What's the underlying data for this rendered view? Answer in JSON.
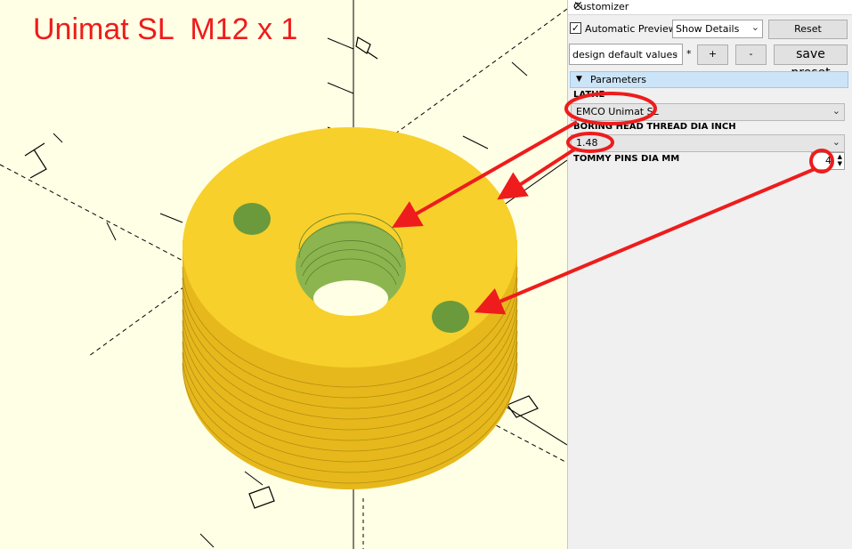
{
  "viewport": {
    "title": "Unimat SL  M12 x 1"
  },
  "panel": {
    "title": "Customizer",
    "close_glyph": "×",
    "checkbox_checked": "✓",
    "auto_preview_label": "Automatic Preview",
    "show_details_value": "Show Details",
    "reset_label": "Reset",
    "preset_value": "design default values",
    "preset_modified": "*",
    "add_label": "+",
    "remove_label": "-",
    "save_preset_label": "save preset",
    "section_label": "Parameters",
    "section_icon": "triangle-down-icon",
    "params": [
      {
        "label": "LATHE",
        "value": "EMCO Unimat SL"
      },
      {
        "label": "BORING HEAD THREAD DIA INCH",
        "value": "1.48"
      },
      {
        "label": "TOMMY PINS DIA MM",
        "value": "4"
      }
    ]
  },
  "colors": {
    "background": "#ffffe5",
    "part": "#f7d02c",
    "thread": "#8db54f",
    "annotation": "#ee1c1c"
  }
}
